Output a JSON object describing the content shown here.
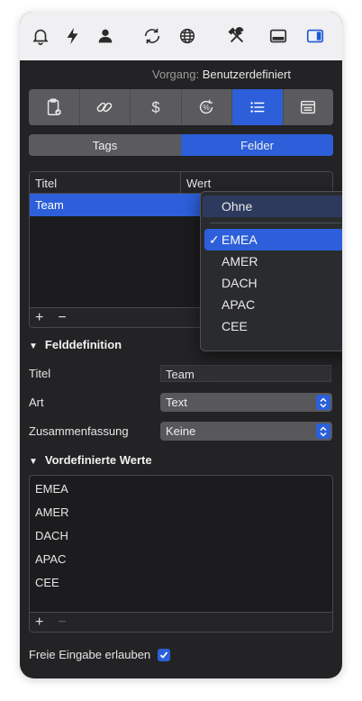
{
  "toolbar": {
    "icons": [
      "bell-icon",
      "bolt-icon",
      "person-icon",
      "sync-icon",
      "globe-icon",
      "tools-icon",
      "bottom-panel-icon",
      "sidebar-icon"
    ]
  },
  "header": {
    "label": "Vorgang:",
    "value": "Benutzerdefiniert"
  },
  "segments": [
    "clipboard-check-icon",
    "link-icon",
    "dollar-icon",
    "percent-cycle-icon",
    "list-icon",
    "card-icon"
  ],
  "tabs": [
    {
      "label": "Tags",
      "active": false
    },
    {
      "label": "Felder",
      "active": true
    }
  ],
  "table": {
    "columns": [
      "Titel",
      "Wert"
    ],
    "rows": [
      {
        "title": "Team"
      }
    ],
    "footer": {
      "add": "+",
      "remove": "−"
    }
  },
  "popup": {
    "items": [
      "Ohne",
      "EMEA",
      "AMER",
      "DACH",
      "APAC",
      "CEE"
    ],
    "selected": "EMEA",
    "check": "✓"
  },
  "felddefinition": {
    "heading": "Felddefinition",
    "titel_label": "Titel",
    "titel_value": "Team",
    "art_label": "Art",
    "art_value": "Text",
    "zusammenfassung_label": "Zusammenfassung",
    "zusammenfassung_value": "Keine"
  },
  "vordefinierte": {
    "heading": "Vordefinierte Werte",
    "items": [
      "EMEA",
      "AMER",
      "DACH",
      "APAC",
      "CEE"
    ],
    "footer": {
      "add": "+",
      "remove": "−"
    }
  },
  "freie_eingabe": {
    "label": "Freie Eingabe erlauben",
    "checked": true
  },
  "colors": {
    "accent": "#2c5fd9",
    "background": "#232325",
    "toolbar": "#f0f0f2"
  }
}
